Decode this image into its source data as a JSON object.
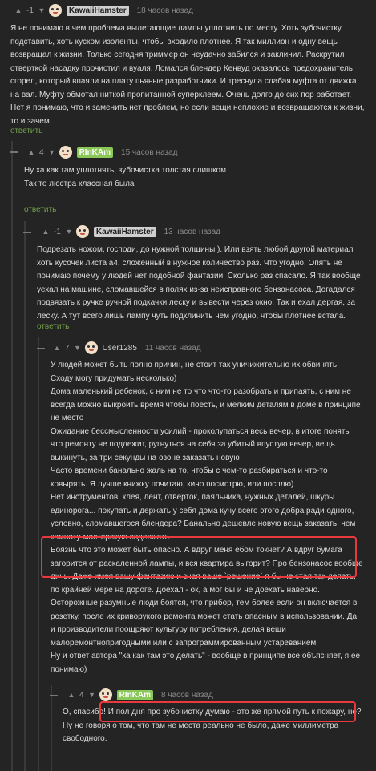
{
  "comments": [
    {
      "score": "-1",
      "author": "KawaiiHamster",
      "time": "18 часов назад",
      "text": "Я не понимаю в чем проблема вылетающие лампы уплотнить по месту. Хоть зубочистку подставить, хоть куском изоленты, чтобы входило плотнее. Я так миллион и одну вещь возвращал к жизни. Только сегодня триммер он неудачно забился и заклинил. Раскрутил отверткой насадку прочистил и вуаля. Ломался блендер Кенвуд оказалось предохранитель сгорел, который впаяли на плату пьяные разработчики. И треснула слабая муфта от движка на вал. Муфту обмотал ниткой пропитанной суперклеем. Очень долго до сих пор работает. Нет я понимаю, что и заменить нет проблем, но если вещи неплохие и возвращаются к жизни, то и зачем.",
      "reply": "ответить"
    },
    {
      "score": "4",
      "author": "RInKAm",
      "time": "15 часов назад",
      "lines": [
        "Ну ха как там уплотнять, зубочистка толстая слишком",
        "",
        "Так то люстра классная была"
      ],
      "reply": "ответить"
    },
    {
      "score": "-1",
      "author": "KawaiiHamster",
      "time": "13 часов назад",
      "text": "Подрезать ножом, господи, до нужной толщины ). Или взять любой другой материал хоть кусочек листа а4, сложенный в нужное количество раз. Что угодно. Опять не понимаю почему у людей нет подобной фантазии. Сколько раз спасало. Я так вообще уехал на машине, сломавшейся в полях из-за неисправного бензонасоса. Догадался подвязать к ручке ручной подкачки леску и вывести через окно. Так и ехал дергая, за леску. А тут всего лишь лампу чуть подклинить чем угодно, чтобы плотнее встала.",
      "reply": "ответить"
    },
    {
      "score": "7",
      "author": "User1285",
      "time": "11 часов назад",
      "paragraphs": [
        "У людей может быть полно причин, не стоит так уничижительно их обвинять. Сходу могу придумать несколько)",
        "Дома маленький ребенок, с ним не то что что-то разобрать и припаять, с ним не всегда можно выкроить время чтобы поесть, и мелким деталям в доме в принципе не место",
        "Ожидание бессмысленности усилий - проколупаться весь вечер, в итоге понять что ремонту не подлежит, ругнуться на себя за убитый впустую вечер, вещь выкинуть, за три секунды на озоне заказать новую",
        "Часто времени банально жаль на то, чтобы с чем-то разбираться и что-то ковырять. Я лучше книжку почитаю, кино посмотрю, или посплю)",
        "Нет инструментов, клея, лент, отверток, паяльника, нужных деталей, шкуры единорога... покупать и держать у себя дома кучу всего этого добра ради одного, условно, сломавшегося блендера? Банально дешевле новую вещь заказать, чем комнату-мастерскую содержать.",
        "Боязнь что это может быть опасно. А вдруг меня ебом токнет? А вдруг бумага загорится от раскаленной лампы, и вся квартира выгорит? Про бензонасос вообще дичь. Даже имея вашу фантазию и зная ваше `решение` я бы не стал так делать, по крайней мере на дороге. Доехал - ок, а мог бы и не доехать наверно.",
        "Осторожные разумные люди боятся, что прибор, тем более если он включается в розетку, после их криворукого ремонта может стать опасным в использовании. Да и производители поощряют культуру потребления, делая вещи малоремонтнопригодными или с запрограммированным устареванием",
        "Ну и ответ автора \"ха как там это делать\" - вообще в принципе все объясняет, я ее понимаю)"
      ]
    },
    {
      "score": "4",
      "author": "RInKAm",
      "time": "8 часов назад",
      "lines": [
        "О, спасибо! И пол дня про зубочистку думаю - это же прямой путь к пожару, не?",
        "",
        "Ну не говоря о том, что там не места реально не было, даже миллиметра свободного."
      ]
    }
  ],
  "icons": {
    "upvote": "chevron-up-icon",
    "downvote": "chevron-down-icon",
    "avatar": "avatar-icon",
    "collapse": "collapse-icon"
  },
  "colors": {
    "background": "#242424",
    "reply": "#72a24a",
    "highlight": "#e8393f",
    "nick_green": "#8ac858",
    "nick_gray": "#cfcfcf"
  }
}
